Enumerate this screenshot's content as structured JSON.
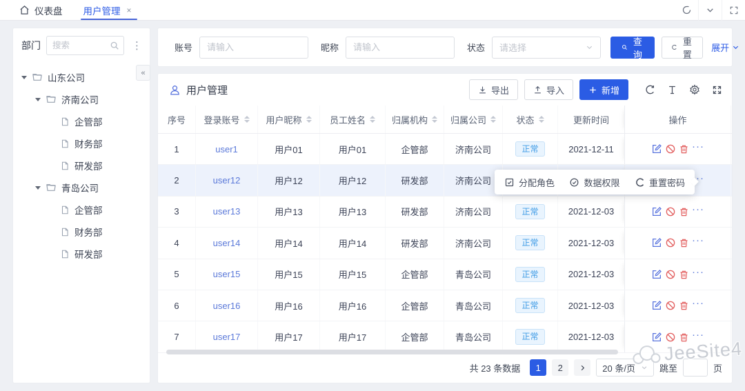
{
  "tabbar": {
    "home_label": "仪表盘",
    "active_tab": "用户管理",
    "close_glyph": "×"
  },
  "sidebar": {
    "title": "部门",
    "search_placeholder": "搜索",
    "collapse_glyph": "«",
    "tree": [
      {
        "label": "山东公司",
        "level": 0,
        "type": "folder"
      },
      {
        "label": "济南公司",
        "level": 1,
        "type": "folder"
      },
      {
        "label": "企管部",
        "level": 2,
        "type": "file"
      },
      {
        "label": "财务部",
        "level": 2,
        "type": "file"
      },
      {
        "label": "研发部",
        "level": 2,
        "type": "file"
      },
      {
        "label": "青岛公司",
        "level": 1,
        "type": "folder"
      },
      {
        "label": "企管部",
        "level": 2,
        "type": "file"
      },
      {
        "label": "财务部",
        "level": 2,
        "type": "file"
      },
      {
        "label": "研发部",
        "level": 2,
        "type": "file"
      }
    ]
  },
  "search_form": {
    "fields": [
      {
        "label": "账号",
        "placeholder": "请输入",
        "type": "input"
      },
      {
        "label": "昵称",
        "placeholder": "请输入",
        "type": "input"
      },
      {
        "label": "状态",
        "placeholder": "请选择",
        "type": "select"
      }
    ],
    "query_label": "查询",
    "reset_label": "重置",
    "expand_label": "展开"
  },
  "panel": {
    "title": "用户管理",
    "export_label": "导出",
    "import_label": "导入",
    "add_label": "新增"
  },
  "table": {
    "columns": [
      "序号",
      "登录账号",
      "用户昵称",
      "员工姓名",
      "归属机构",
      "归属公司",
      "状态",
      "更新时间",
      "操作"
    ],
    "sortable": [
      false,
      true,
      true,
      true,
      true,
      true,
      true,
      false,
      false
    ],
    "status_normal_label": "正常",
    "rows": [
      {
        "seq": "1",
        "account": "user1",
        "nickname": "用户01",
        "name": "用户01",
        "org": "企管部",
        "company": "济南公司",
        "status": "正常",
        "time": "2021-12-11"
      },
      {
        "seq": "2",
        "account": "user12",
        "nickname": "用户12",
        "name": "用户12",
        "org": "研发部",
        "company": "济南公司",
        "status": "",
        "time": ""
      },
      {
        "seq": "3",
        "account": "user13",
        "nickname": "用户13",
        "name": "用户13",
        "org": "研发部",
        "company": "济南公司",
        "status": "正常",
        "time": "2021-12-03"
      },
      {
        "seq": "4",
        "account": "user14",
        "nickname": "用户14",
        "name": "用户14",
        "org": "研发部",
        "company": "济南公司",
        "status": "正常",
        "time": "2021-12-03"
      },
      {
        "seq": "5",
        "account": "user15",
        "nickname": "用户15",
        "name": "用户15",
        "org": "企管部",
        "company": "青岛公司",
        "status": "正常",
        "time": "2021-12-03"
      },
      {
        "seq": "6",
        "account": "user16",
        "nickname": "用户16",
        "name": "用户16",
        "org": "企管部",
        "company": "青岛公司",
        "status": "正常",
        "time": "2021-12-03"
      },
      {
        "seq": "7",
        "account": "user17",
        "nickname": "用户17",
        "name": "用户17",
        "org": "企管部",
        "company": "青岛公司",
        "status": "正常",
        "time": "2021-12-03"
      }
    ],
    "highlighted_row_index": 1
  },
  "context_menu": {
    "items": [
      {
        "label": "分配角色",
        "icon": "assign-role-icon"
      },
      {
        "label": "数据权限",
        "icon": "data-permission-icon"
      },
      {
        "label": "重置密码",
        "icon": "reset-password-icon"
      }
    ]
  },
  "pagination": {
    "total_text": "共 23 条数据",
    "pages": [
      "1",
      "2"
    ],
    "active_page": "1",
    "page_size": "20 条/页",
    "jump_prefix": "跳至",
    "jump_value": "",
    "jump_suffix": "页"
  },
  "watermark": "JeeSite4",
  "icons": {
    "home": "home-icon",
    "refresh": "refresh-icon",
    "chevron_down": "chevron-down-icon",
    "fullscreen": "fullscreen-icon",
    "search": "search-icon",
    "more_vertical": "kebab-menu-icon",
    "folder": "folder-icon",
    "file": "file-icon",
    "export": "download-icon",
    "import": "upload-icon",
    "plus": "plus-icon",
    "row_height": "row-height-icon",
    "gear": "gear-icon",
    "user": "user-icon",
    "edit": "edit-icon",
    "disable": "ban-icon",
    "delete": "trash-icon",
    "more": "ellipsis-icon"
  },
  "colors": {
    "primary": "#2b5ce4",
    "tab_active": "#2e5ce6",
    "link": "#5b79d9",
    "danger": "#e25d5d",
    "status_badge_bg": "#e9f4fe",
    "status_badge_text": "#3f9be5",
    "row_highlight": "#edf2fc",
    "page_bg": "#eef0f4"
  }
}
